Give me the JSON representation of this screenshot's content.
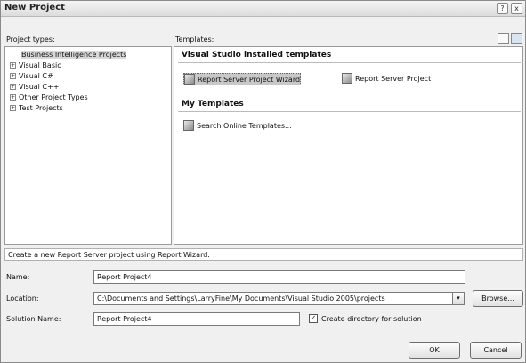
{
  "window": {
    "title": "New Project",
    "help_glyph": "?",
    "close_glyph": "x"
  },
  "labels": {
    "project_types": "Project types:",
    "templates": "Templates:",
    "name": "Name:",
    "location": "Location:",
    "solution_name": "Solution Name:"
  },
  "project_types": [
    {
      "label": "Business Intelligence Projects",
      "expander": "",
      "selected": true
    },
    {
      "label": "Visual Basic",
      "expander": "+"
    },
    {
      "label": "Visual C#",
      "expander": "+"
    },
    {
      "label": "Visual C++",
      "expander": "+"
    },
    {
      "label": "Other Project Types",
      "expander": "+"
    },
    {
      "label": "Test Projects",
      "expander": "+"
    }
  ],
  "templates": {
    "installed_header": "Visual Studio installed templates",
    "installed": [
      {
        "label": "Report Server Project Wizard",
        "selected": true
      },
      {
        "label": "Report Server Project"
      }
    ],
    "my_header": "My Templates",
    "my": [
      {
        "label": "Search Online Templates..."
      }
    ]
  },
  "status_text": "Create a new Report Server project using Report Wizard.",
  "fields": {
    "name_value": "Report Project4",
    "location_value": "C:\\Documents and Settings\\LarryFine\\My Documents\\Visual Studio 2005\\projects",
    "solution_name_value": "Report Project4"
  },
  "checkbox": {
    "label": "Create directory for solution",
    "checked": true,
    "check_glyph": "✓"
  },
  "buttons": {
    "browse": "Browse...",
    "ok": "OK",
    "cancel": "Cancel",
    "dropdown_glyph": "▾"
  }
}
